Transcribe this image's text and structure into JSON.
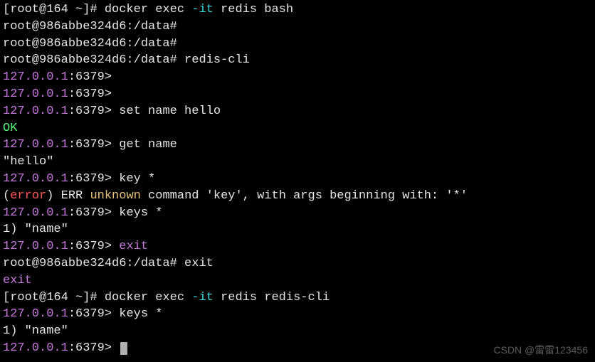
{
  "lines": [
    {
      "id": 0,
      "segments": [
        {
          "cls": "white",
          "text": "[root@164 ~]# docker exec "
        },
        {
          "cls": "cyan",
          "text": "-it"
        },
        {
          "cls": "white",
          "text": " redis bash"
        }
      ]
    },
    {
      "id": 1,
      "segments": [
        {
          "cls": "white",
          "text": "root@986abbe324d6:/data#"
        }
      ]
    },
    {
      "id": 2,
      "segments": [
        {
          "cls": "white",
          "text": "root@986abbe324d6:/data#"
        }
      ]
    },
    {
      "id": 3,
      "segments": [
        {
          "cls": "white",
          "text": "root@986abbe324d6:/data# redis-cli"
        }
      ]
    },
    {
      "id": 4,
      "segments": [
        {
          "cls": "magenta",
          "text": "127.0.0.1"
        },
        {
          "cls": "white",
          "text": ":6379>"
        }
      ]
    },
    {
      "id": 5,
      "segments": [
        {
          "cls": "magenta",
          "text": "127.0.0.1"
        },
        {
          "cls": "white",
          "text": ":6379>"
        }
      ]
    },
    {
      "id": 6,
      "segments": [
        {
          "cls": "magenta",
          "text": "127.0.0.1"
        },
        {
          "cls": "white",
          "text": ":6379> set name hello"
        }
      ]
    },
    {
      "id": 7,
      "segments": [
        {
          "cls": "green",
          "text": "OK"
        }
      ]
    },
    {
      "id": 8,
      "segments": [
        {
          "cls": "magenta",
          "text": "127.0.0.1"
        },
        {
          "cls": "white",
          "text": ":6379> get name"
        }
      ]
    },
    {
      "id": 9,
      "segments": [
        {
          "cls": "white",
          "text": "\"hello\""
        }
      ]
    },
    {
      "id": 10,
      "segments": [
        {
          "cls": "magenta",
          "text": "127.0.0.1"
        },
        {
          "cls": "white",
          "text": ":6379> key *"
        }
      ]
    },
    {
      "id": 11,
      "segments": [
        {
          "cls": "white",
          "text": "("
        },
        {
          "cls": "red",
          "text": "error"
        },
        {
          "cls": "white",
          "text": ") ERR "
        },
        {
          "cls": "yellow",
          "text": "unknown"
        },
        {
          "cls": "white",
          "text": " command 'key', with args beginning with: '*'"
        }
      ]
    },
    {
      "id": 12,
      "segments": [
        {
          "cls": "magenta",
          "text": "127.0.0.1"
        },
        {
          "cls": "white",
          "text": ":6379> keys *"
        }
      ]
    },
    {
      "id": 13,
      "segments": [
        {
          "cls": "white",
          "text": "1) \"name\""
        }
      ]
    },
    {
      "id": 14,
      "segments": [
        {
          "cls": "magenta",
          "text": "127.0.0.1"
        },
        {
          "cls": "white",
          "text": ":6379> "
        },
        {
          "cls": "magenta",
          "text": "exit"
        }
      ]
    },
    {
      "id": 15,
      "segments": [
        {
          "cls": "white",
          "text": "root@986abbe324d6:/data# exit"
        }
      ]
    },
    {
      "id": 16,
      "segments": [
        {
          "cls": "magenta",
          "text": "exit"
        }
      ]
    },
    {
      "id": 17,
      "segments": [
        {
          "cls": "white",
          "text": "[root@164 ~]# docker exec "
        },
        {
          "cls": "cyan",
          "text": "-it"
        },
        {
          "cls": "white",
          "text": " redis redis-cli"
        }
      ]
    },
    {
      "id": 18,
      "segments": [
        {
          "cls": "magenta",
          "text": "127.0.0.1"
        },
        {
          "cls": "white",
          "text": ":6379> keys *"
        }
      ]
    },
    {
      "id": 19,
      "segments": [
        {
          "cls": "white",
          "text": "1) \"name\""
        }
      ]
    },
    {
      "id": 20,
      "segments": [
        {
          "cls": "magenta",
          "text": "127.0.0.1"
        },
        {
          "cls": "white",
          "text": ":6379> "
        }
      ],
      "cursor": true
    }
  ],
  "watermark": "CSDN @雷雷123456"
}
